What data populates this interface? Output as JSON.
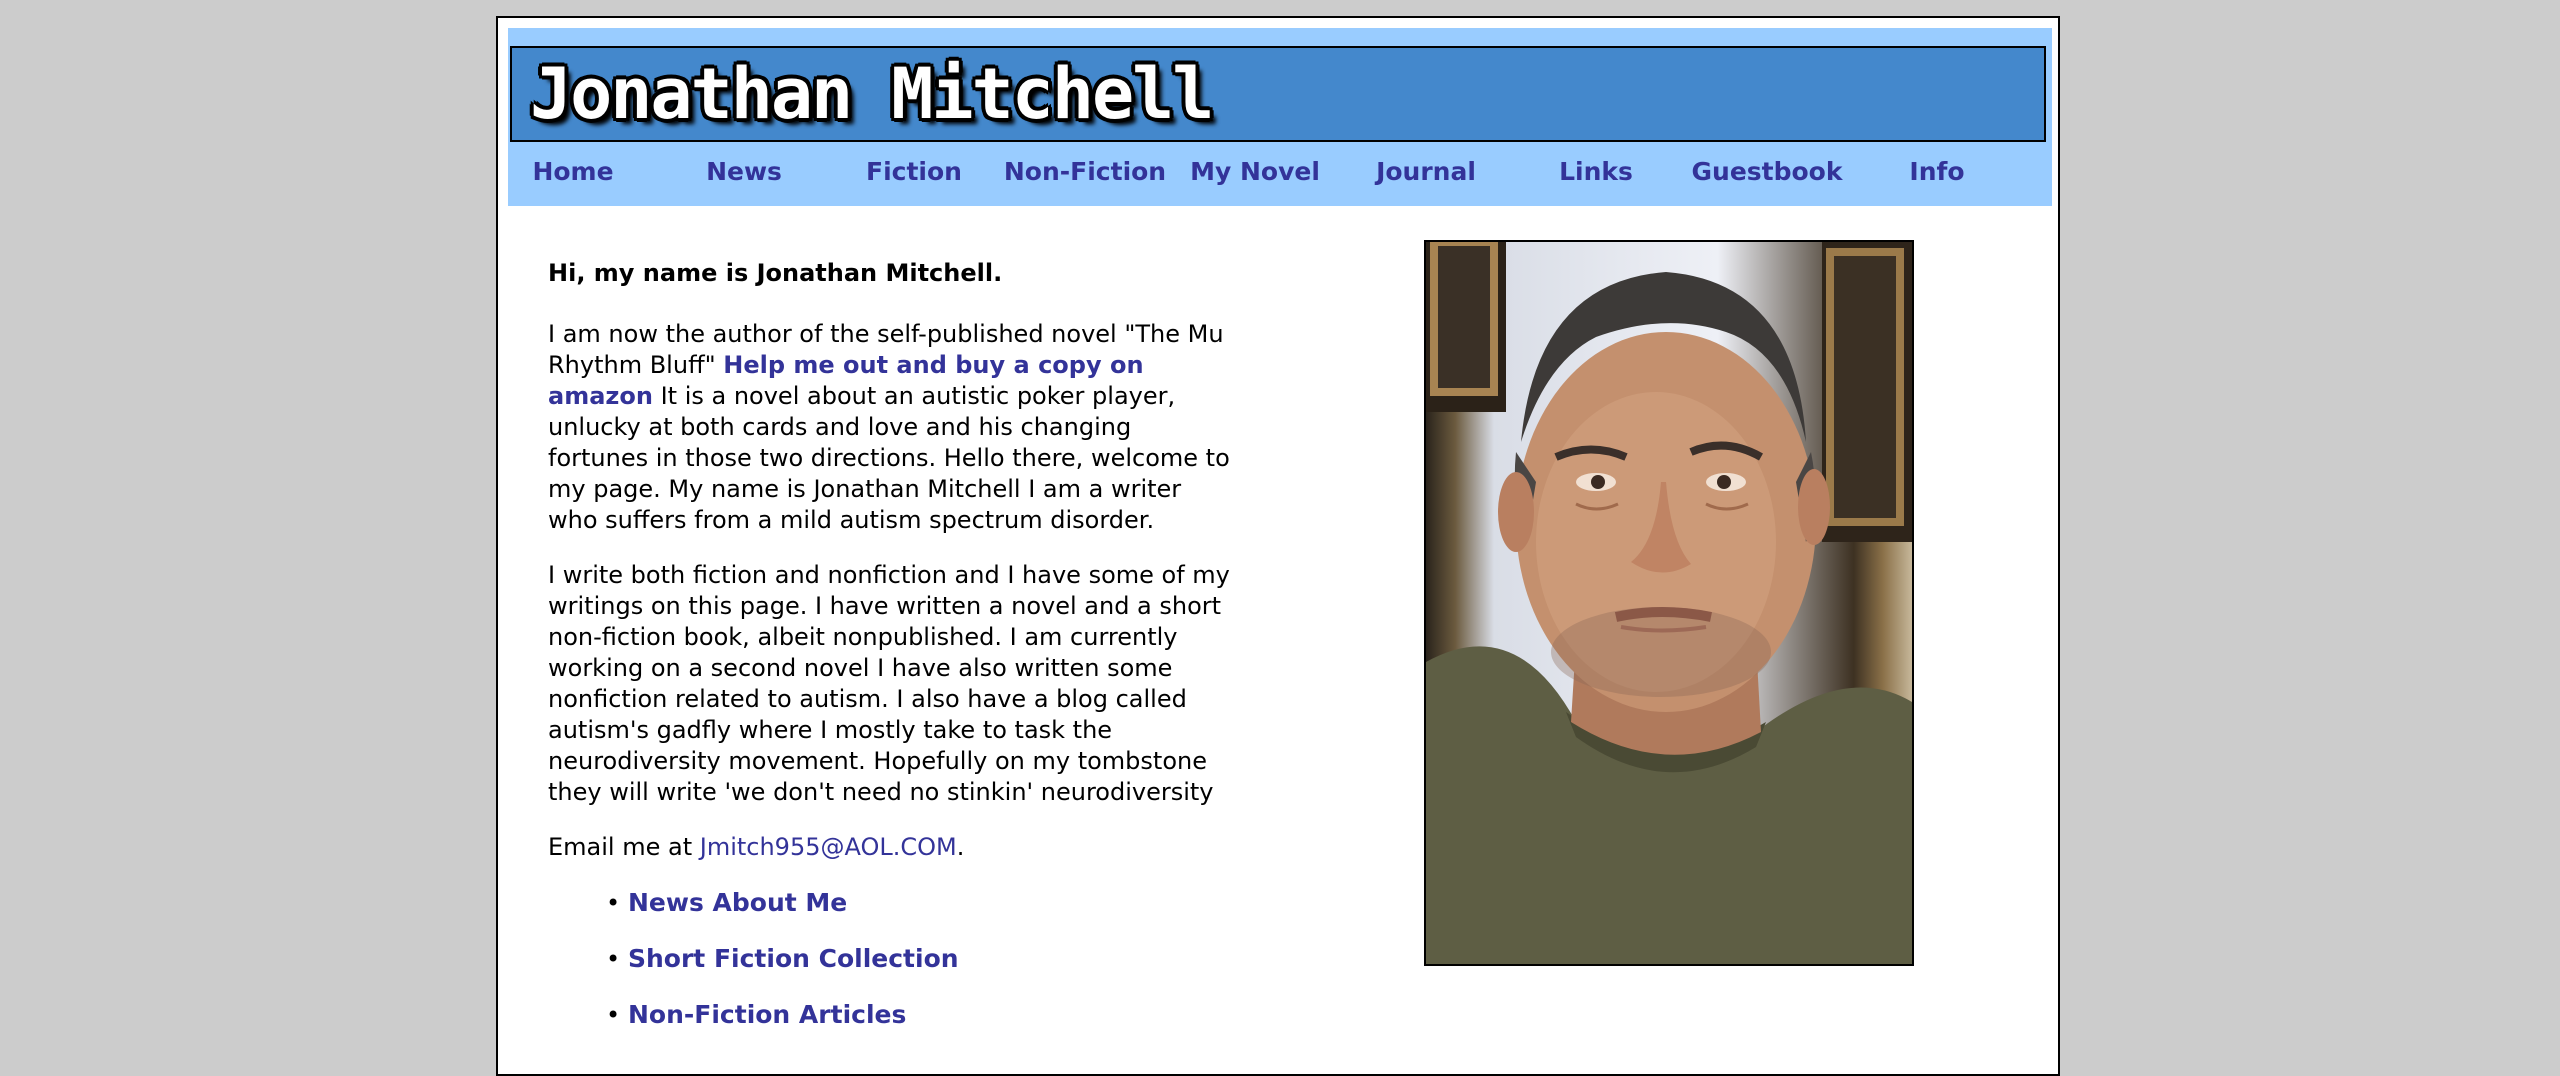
{
  "header": {
    "site_title": "Jonathan Mitchell",
    "nav": [
      {
        "label": "Home"
      },
      {
        "label": "News"
      },
      {
        "label": "Fiction"
      },
      {
        "label": "Non-Fiction"
      },
      {
        "label": "My Novel"
      },
      {
        "label": "Journal"
      },
      {
        "label": "Links"
      },
      {
        "label": "Guestbook"
      },
      {
        "label": "Info"
      }
    ]
  },
  "main": {
    "greeting": "Hi, my name is Jonathan Mitchell.",
    "intro_before_link": "I am now the author of the self-published novel \"The Mu Rhythm Bluff\" ",
    "amazon_link": "Help me out and buy a copy on amazon",
    "intro_after_link": " It is a novel about an autistic poker player, unlucky at both cards and love and his changing fortunes in those two directions. Hello there, welcome to my page. My name is Jonathan Mitchell I am a writer who suffers from a mild autism spectrum disorder.",
    "paragraph2": "I write both fiction and nonfiction and I have some of my writings on this page. I have written a novel and a short non-fiction book, albeit nonpublished. I am currently working on a second novel I have also written some nonfiction related to autism. I also have a blog called autism's gadfly where I mostly take to task the neurodiversity movement. Hopefully on my tombstone they will write 'we don't need no stinkin' neurodiversity",
    "email_prefix": "Email me at ",
    "email": "Jmitch955@AOL.COM",
    "email_suffix": ".",
    "links": [
      {
        "label": "News About Me"
      },
      {
        "label": "Short Fiction Collection"
      },
      {
        "label": "Non-Fiction Articles"
      }
    ]
  },
  "colors": {
    "header_bg": "#99ccff",
    "banner_bg": "#4488cc",
    "link": "#333399",
    "page_bg": "#cccccc"
  }
}
